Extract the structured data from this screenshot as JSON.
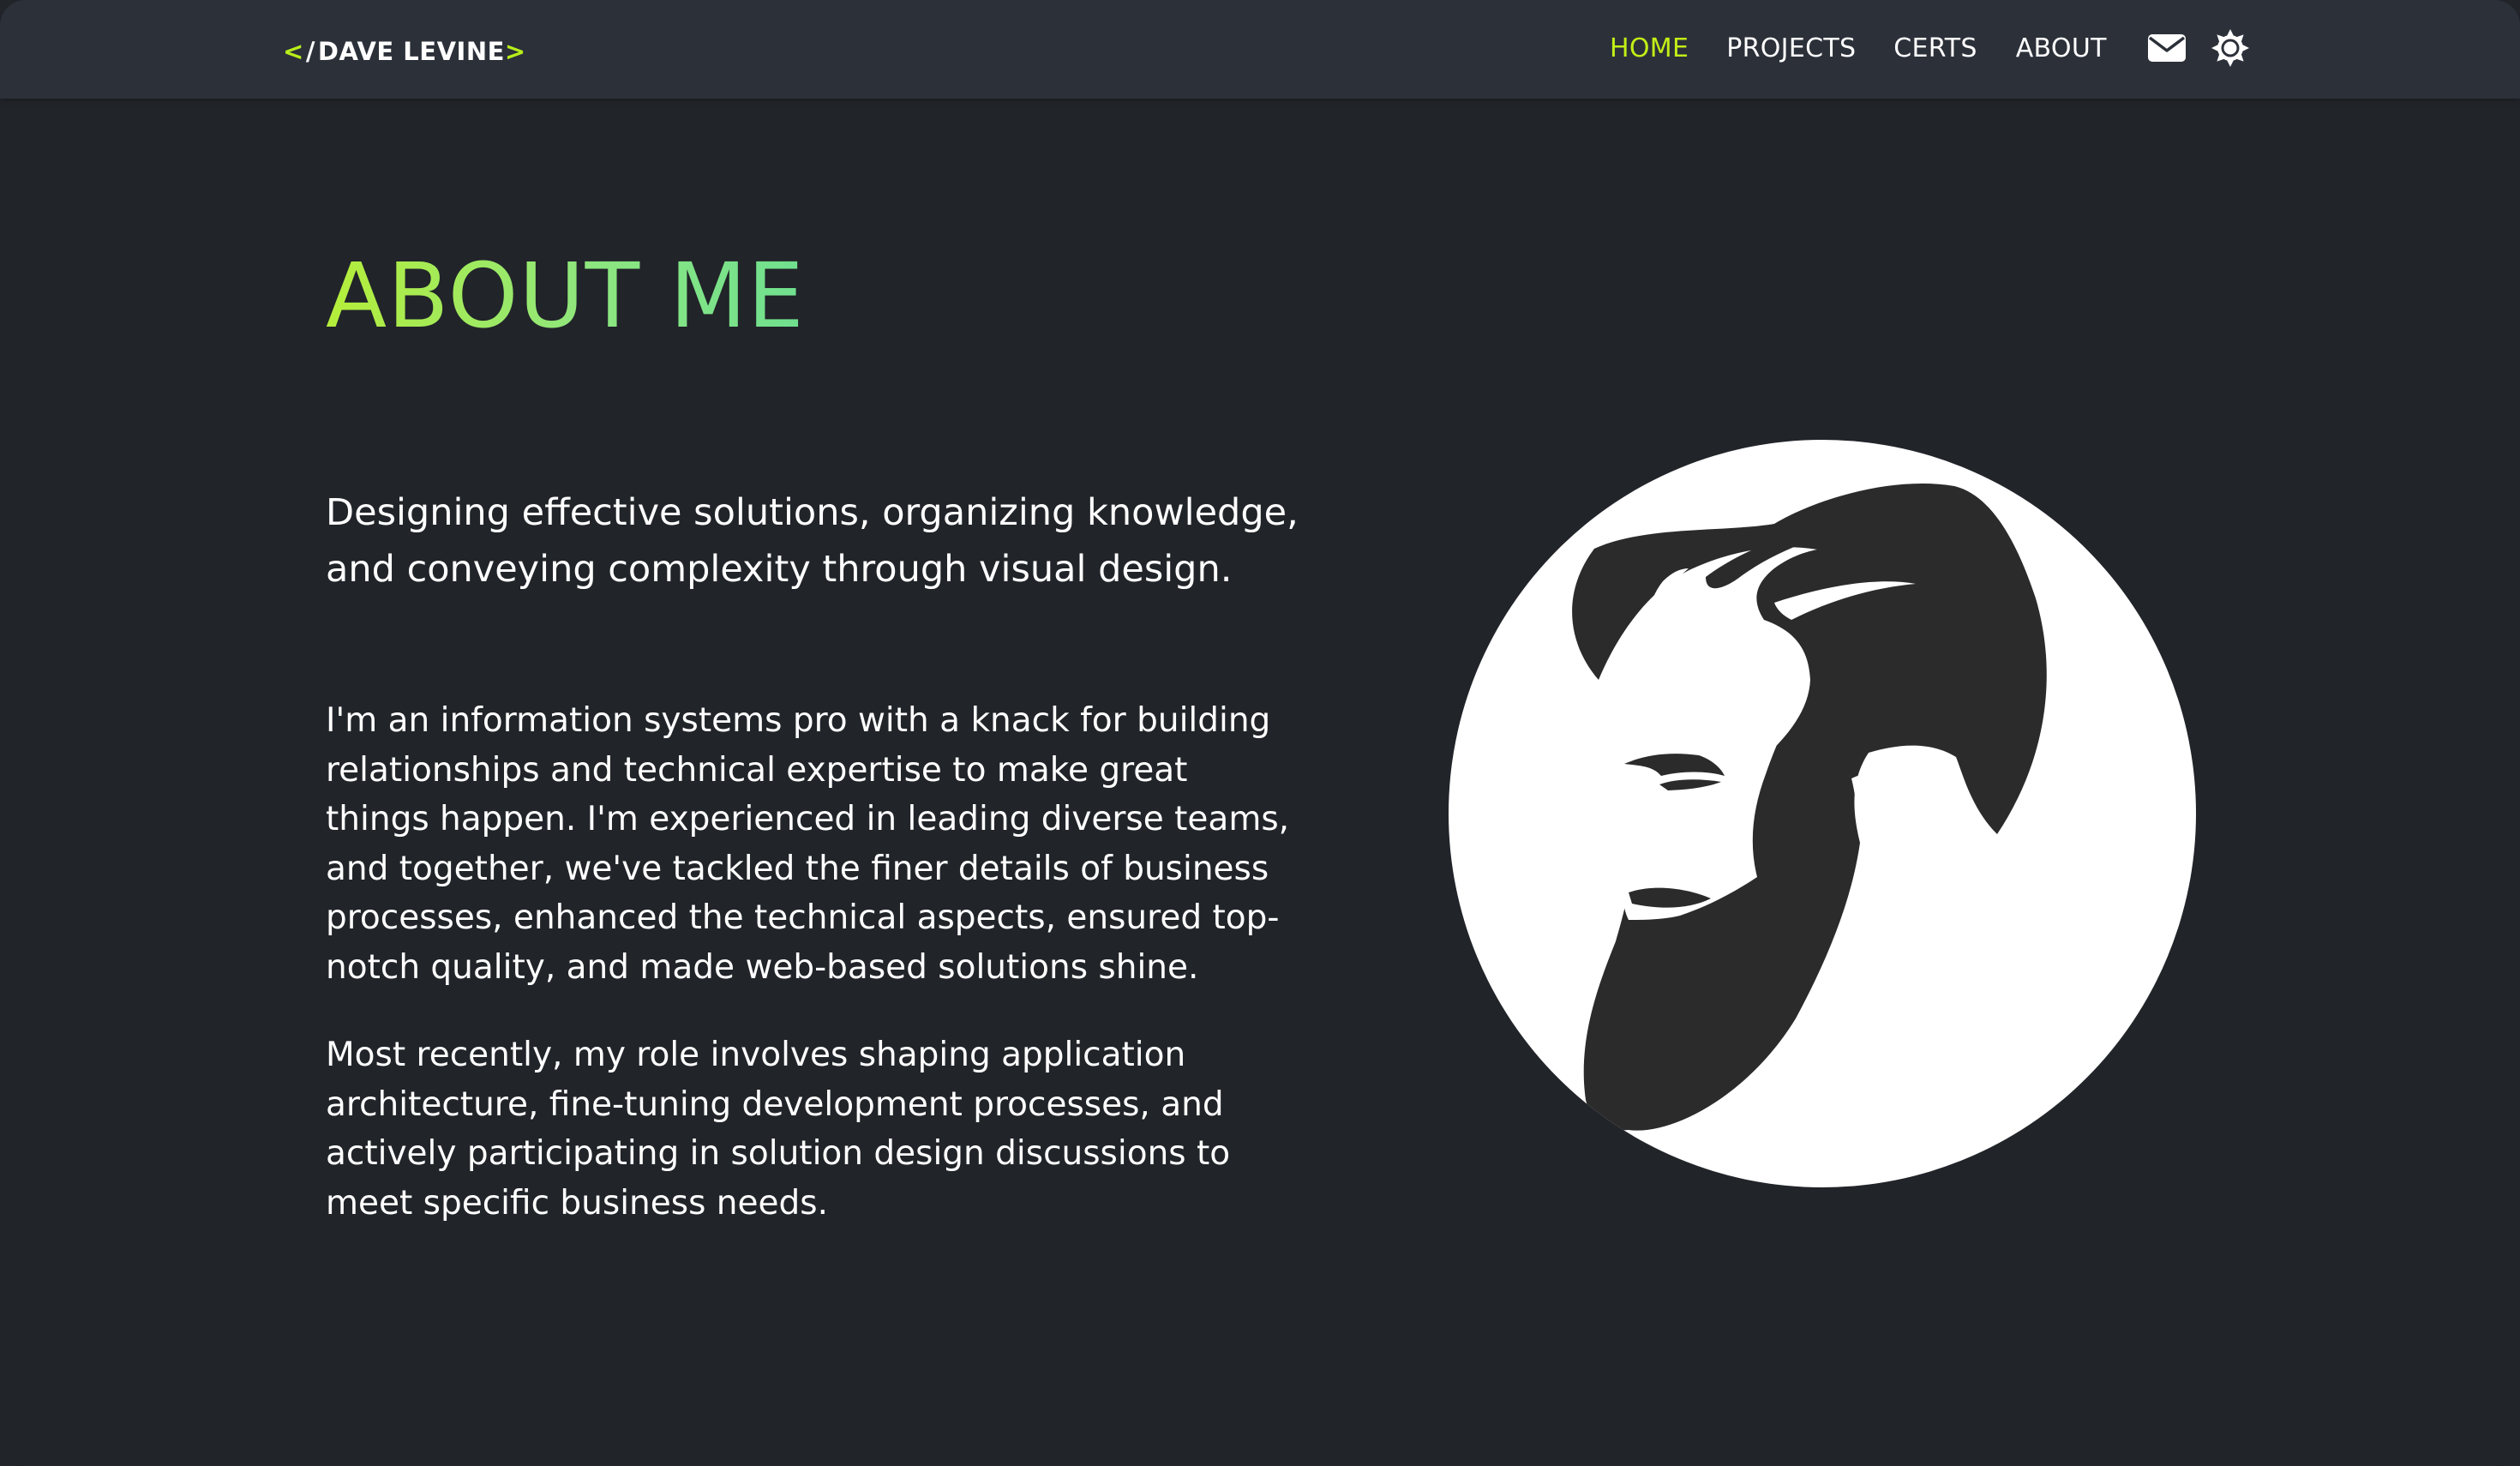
{
  "header": {
    "brand": {
      "open_bracket": "<",
      "slash": "/",
      "name": "DAVE LEVINE",
      "close_bracket": ">"
    },
    "nav": [
      {
        "label": "HOME",
        "active": true
      },
      {
        "label": "PROJECTS",
        "active": false
      },
      {
        "label": "CERTS",
        "active": false
      },
      {
        "label": "ABOUT",
        "active": false
      }
    ],
    "icons": {
      "mail": "mail-icon",
      "theme": "sun-gear-icon"
    }
  },
  "main": {
    "title": "ABOUT ME",
    "tagline": "Designing effective solutions, organizing knowledge, and conveying complexity through visual design.",
    "paragraphs": [
      "I'm an information systems pro with a knack for building relationships and technical expertise to make great things happen. I'm experienced in leading diverse teams, and together, we've tackled the finer details of business processes, enhanced the technical aspects, ensured top-notch quality, and made web-based solutions shine.",
      "Most recently, my role involves shaping application architecture, fine-tuning development processes, and actively participating in solution design discussions to meet specific business needs."
    ],
    "avatar": "bearded-man-silhouette-logo"
  },
  "colors": {
    "background": "#212429",
    "navbar": "#2c3039",
    "accent": "#c2ee17",
    "title_gradient_start": "#b5ee3a",
    "title_gradient_end": "#6fe08f",
    "silhouette": "#2b2b2b"
  }
}
